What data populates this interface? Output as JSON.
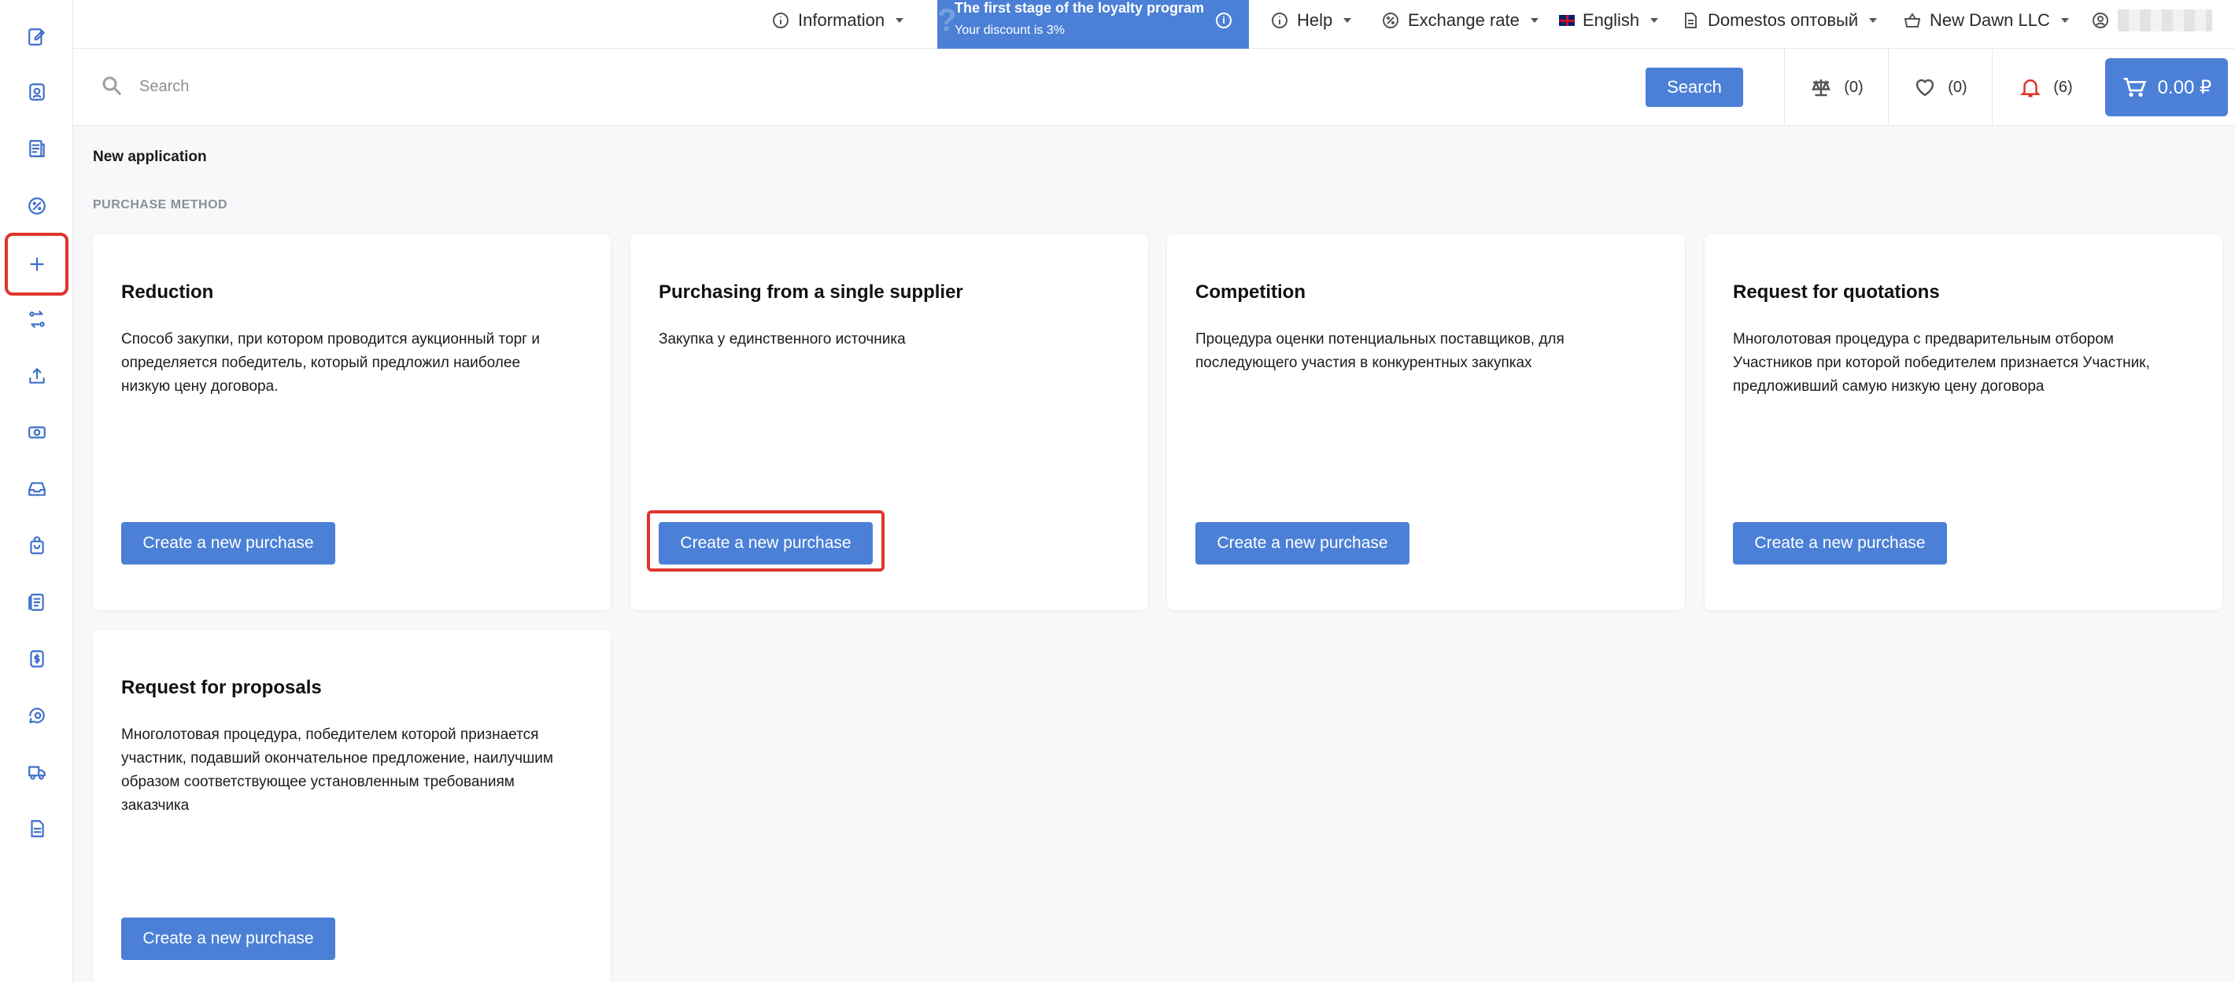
{
  "sidebar": {
    "items": [
      {
        "icon": "edit-icon"
      },
      {
        "icon": "profile-card-icon"
      },
      {
        "icon": "document-list-icon"
      },
      {
        "icon": "percent-icon"
      },
      {
        "icon": "plus-icon",
        "selected": true
      },
      {
        "icon": "exchange-icon"
      },
      {
        "icon": "upload-icon"
      },
      {
        "icon": "money-icon"
      },
      {
        "icon": "inbox-icon"
      },
      {
        "icon": "bag-icon"
      },
      {
        "icon": "catalog-icon"
      },
      {
        "icon": "dollar-doc-icon"
      },
      {
        "icon": "chat-search-icon"
      },
      {
        "icon": "truck-icon"
      },
      {
        "icon": "file-icon"
      }
    ]
  },
  "topbar": {
    "information": "Information",
    "loyalty_title": "The first stage of the loyalty program",
    "loyalty_subtitle": "Your discount is 3%",
    "help": "Help",
    "exchange_rate": "Exchange rate",
    "language": "English",
    "store": "Domestos оптовый",
    "company": "New Dawn LLC"
  },
  "search": {
    "placeholder": "Search",
    "button": "Search"
  },
  "counters": {
    "compare": "(0)",
    "favorites": "(0)",
    "notifications": "(6)",
    "cart_total": "0.00 ₽"
  },
  "main": {
    "title": "New application",
    "section_label": "PURCHASE METHOD",
    "cards": [
      {
        "title": "Reduction",
        "description": "Способ закупки, при котором проводится аукционный торг и определяется победитель, который предложил наиболее низкую цену договора.",
        "button": "Create a new purchase"
      },
      {
        "title": "Purchasing from a single supplier",
        "description": "Закупка у единственного источника",
        "button": "Create a new purchase"
      },
      {
        "title": "Competition",
        "description": "Процедура оценки потенциальных поставщиков, для последующего участия в конкурентных закупках",
        "button": "Create a new purchase"
      },
      {
        "title": "Request for quotations",
        "description": "Многолотовая процедура с предварительным отбором Участников при которой победителем признается Участник, предложивший самую низкую цену договора",
        "button": "Create a new purchase"
      },
      {
        "title": "Request for proposals",
        "description": "Многолотовая процедура, победителем которой признается участник, подавший окончательное предложение, наилучшим образом соответствующее установленным требованиям заказчика",
        "button": "Create a new purchase"
      }
    ]
  },
  "colors": {
    "accent": "#4b80d6",
    "highlight": "#e0352b",
    "notification": "#e0352b"
  }
}
